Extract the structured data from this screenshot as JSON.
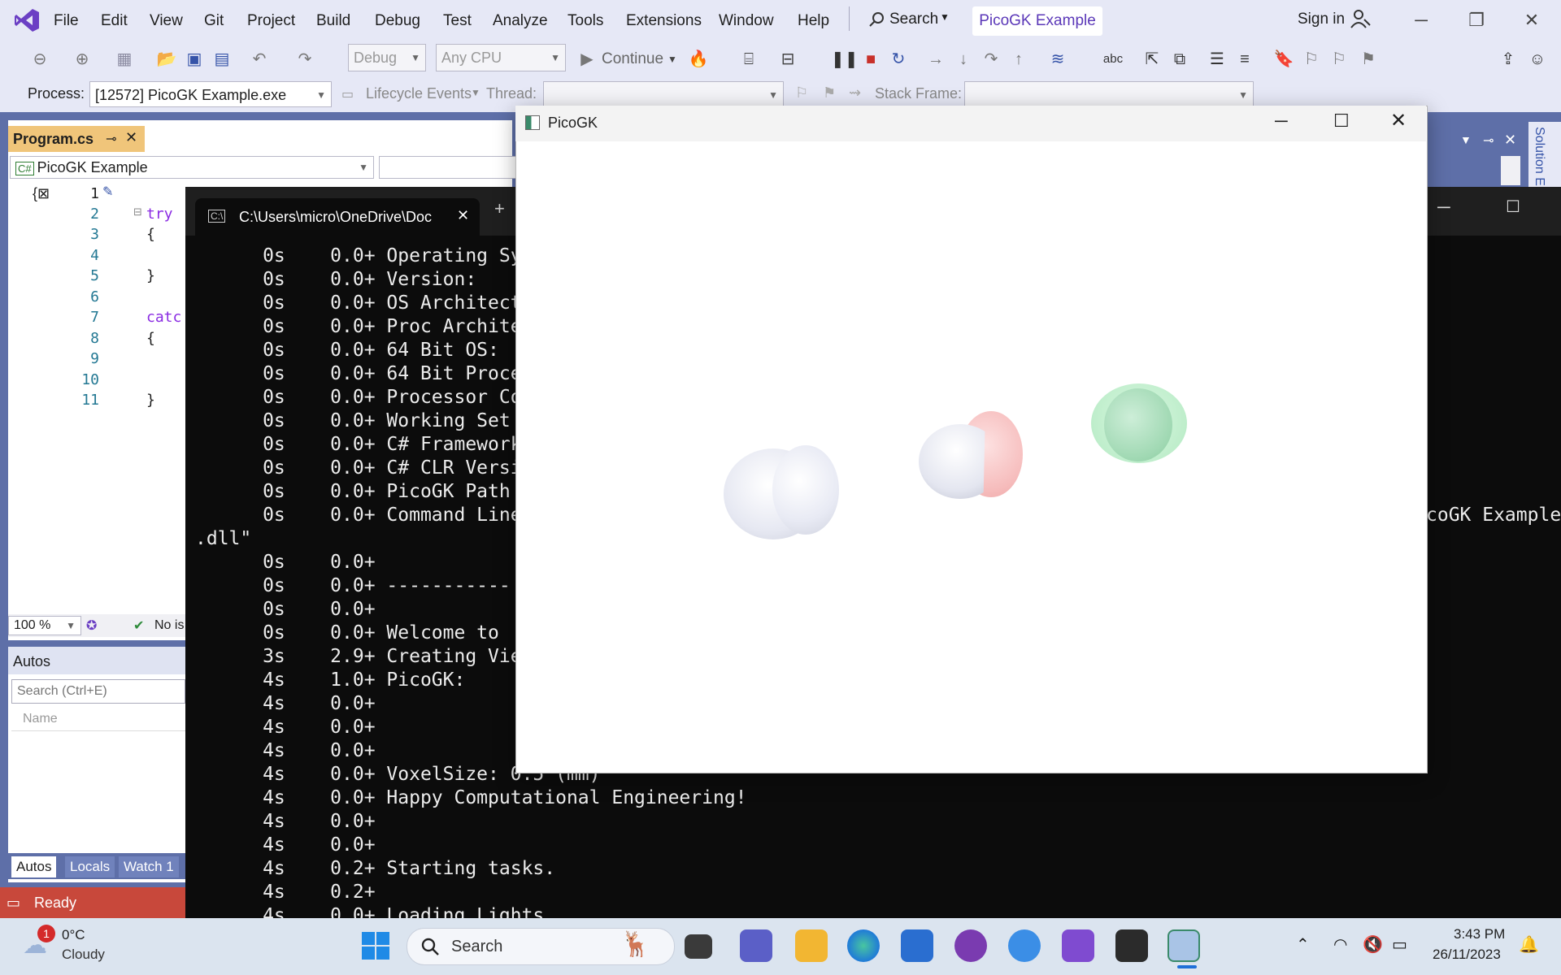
{
  "menubar": {
    "items": [
      "File",
      "Edit",
      "View",
      "Git",
      "Project",
      "Build",
      "Debug",
      "Test",
      "Analyze",
      "Tools",
      "Extensions",
      "Window",
      "Help"
    ],
    "search_label": "Search",
    "project_name": "PicoGK Example",
    "sign_in": "Sign in"
  },
  "toolbar": {
    "config": "Debug",
    "platform": "Any CPU",
    "continue_label": "Continue"
  },
  "toolbar2": {
    "process_label": "Process:",
    "process_value": "[12572] PicoGK Example.exe",
    "lifecycle_label": "Lifecycle Events",
    "thread_label": "Thread:",
    "stack_label": "Stack Frame:"
  },
  "editor": {
    "tab_label": "Program.cs",
    "nav_project": "PicoGK Example",
    "line_numbers": [
      "1",
      "2",
      "3",
      "4",
      "5",
      "6",
      "7",
      "8",
      "9",
      "10",
      "11"
    ],
    "code": {
      "try": "try",
      "catch": "catc",
      "open": "{",
      "close": "}"
    },
    "zoom": "100 %",
    "issues": "No is"
  },
  "autos": {
    "title": "Autos",
    "search_placeholder": "Search (Ctrl+E)",
    "col_name": "Name",
    "tabs": [
      "Autos",
      "Locals",
      "Watch 1"
    ]
  },
  "side_panel": {
    "solution_label": "Solution E"
  },
  "status": {
    "text": "Ready"
  },
  "console": {
    "tab_title": "C:\\Users\\micro\\OneDrive\\Doc",
    "lines": [
      "      0s    0.0+ Operating Sy",
      "      0s    0.0+ Version:",
      "      0s    0.0+ OS Architect",
      "      0s    0.0+ Proc Archite",
      "      0s    0.0+ 64 Bit OS:",
      "      0s    0.0+ 64 Bit Proce",
      "      0s    0.0+ Processor Co",
      "      0s    0.0+ Working Set",
      "      0s    0.0+ C# Framework",
      "      0s    0.0+ C# CLR Versi",
      "      0s    0.0+ PicoGK Path",
      "      0s    0.0+ Command Line",
      ".dll\"",
      "      0s    0.0+",
      "      0s    0.0+ -----------",
      "      0s    0.0+",
      "      0s    0.0+ Welcome to",
      "      3s    2.9+ Creating Vie",
      "      4s    1.0+ PicoGK:",
      "      4s    0.0+",
      "      4s    0.0+",
      "      4s    0.0+",
      "      4s    0.0+ VoxelSize: 0.5 (mm)",
      "      4s    0.0+ Happy Computational Engineering!",
      "      4s    0.0+",
      "      4s    0.0+",
      "      4s    0.2+ Starting tasks.",
      "      4s    0.2+",
      "      4s    0.0+ Loading Lights"
    ],
    "right_fragment": "coGK Example"
  },
  "picogk": {
    "title": "PicoGK",
    "sphere_colors": {
      "white": "#eef0f8",
      "pink": "#f6b8b8",
      "green": "#b4ecc4"
    }
  },
  "taskbar": {
    "weather_temp": "0°C",
    "weather_desc": "Cloudy",
    "weather_badge": "1",
    "search_label": "Search",
    "time": "3:43 PM",
    "date": "26/11/2023"
  }
}
